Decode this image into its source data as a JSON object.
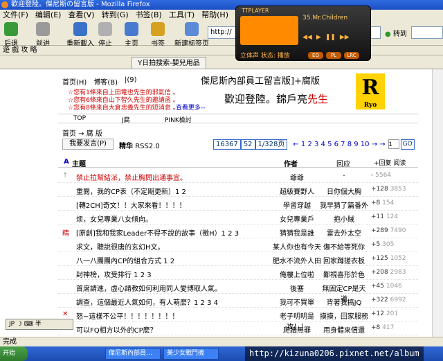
{
  "window": {
    "title": "歡迎登陸。傑尼斯の留言版 - Mozilla Firefox"
  },
  "menu": [
    "文件(F)",
    "编辑(E)",
    "查看(V)",
    "转到(G)",
    "书签(B)",
    "工具(T)",
    "帮助(H)"
  ],
  "toolbar": {
    "back": "后退",
    "forward": "前进",
    "reload": "重新載入",
    "stop": "停止",
    "home": "主页",
    "bookmarks": "书签",
    "newtab": "新建标签页",
    "url": "http://",
    "goto": "转到"
  },
  "bookmarks_bar": "遊 戲 攻 略",
  "tabs": [
    "Y日拍搜索-嬰兒用品"
  ],
  "player": {
    "name": "TTPLAYER",
    "song": "35.Mr.Children",
    "status": "立体声 状态: 播放",
    "buttons": [
      "EQ",
      "PL",
      "LRC"
    ]
  },
  "board": {
    "header_links": [
      "首页(H)",
      "博客(B)",
      "|(9)"
    ],
    "title": "傑尼斯內部員工留言版]+腐版",
    "welcome_lines": [
      "☆您有1條來自上田竜也先生的邪氣信 。",
      "☆您有6條來自山下智久先生的邀請函 。",
      "☆您有8條來自大倉忠義先生的短消息 。"
    ],
    "more": "查看更多--",
    "welcome": "歡迎登陸。錦戶亮",
    "welcome_name": "先生",
    "logo": "R",
    "logo_sub": "Ryo",
    "nav": [
      "TOP",
      "J腐",
      "PINK檢討"
    ],
    "breadcrumb": "首页 → 腐 版",
    "post_button": "我要发言(P)",
    "rss_bold": "精华",
    "rss": "RSS2.0",
    "pager": {
      "total": "16367",
      "per": "52",
      "page": "1/328页",
      "pages": "← 1 2 3 4 5 6 7 8 9 10 → →",
      "input": "1",
      "go": "GO"
    },
    "list_head": {
      "title": "主题",
      "author": "作者",
      "reply": "回应",
      "stats": "+回复 阅读"
    }
  },
  "rows": [
    {
      "mark": "↑",
      "title": "禁止拉幫結派，禁止胸問出通事宜。",
      "author": "爺爺",
      "reply": "-",
      "count": "-",
      "views": "5564",
      "color": "#c00"
    },
    {
      "mark": "",
      "title": "重閱，我的CP表（不定期更新）1 2",
      "author": "超級賽野人",
      "reply": "日你個大胸",
      "count": "+128",
      "views": "3853",
      "color": "#000"
    },
    {
      "mark": "",
      "title": "[轉2CH]奇文！！大家來看！！！！",
      "author": "學習穿越",
      "reply": "我早猜了篇番外",
      "count": "+8",
      "views": "154",
      "color": "#000"
    },
    {
      "mark": "",
      "title": "烦，女兒專業八女傾向。",
      "author": "女兒專業戶",
      "reply": "抱小賊",
      "count": "+11",
      "views": "124",
      "color": "#000"
    },
    {
      "mark": "精",
      "title": "[原創]我和我家Leader不得不說的故事（徵H）1 2 3",
      "author": "猜猜我是誰",
      "reply": "雷去外太空",
      "count": "+289",
      "views": "7490",
      "color": "#000"
    },
    {
      "mark": "",
      "title": "求文，聽說很唐的玄幻H文。",
      "author": "某人你也有今天",
      "reply": "傷不給等死你",
      "count": "+5",
      "views": "305",
      "color": "#000"
    },
    {
      "mark": "",
      "title": "八一八團團內CP的組合方式 1 2",
      "author": "肥水不流外人田",
      "reply": "回家蹲搓衣板",
      "count": "+125",
      "views": "1052",
      "color": "#000"
    },
    {
      "mark": "",
      "title": "封神榜，攻受排行 1 2 3",
      "author": "俺樓上位啦",
      "reply": "鄙視喜形於色",
      "count": "+208",
      "views": "2983",
      "color": "#000"
    },
    {
      "mark": "",
      "title": "首席請進，虛心請教如何利用同人愛博取人氣。",
      "author": "後塞",
      "reply": "無固定CP是天道",
      "count": "+45",
      "views": "1046",
      "color": "#000"
    },
    {
      "mark": "",
      "title": "調查，這個最近人氣如何，有人萌麼？1 2 3 4",
      "author": "我可不買單",
      "reply": "背著我搞JQ",
      "count": "+322",
      "views": "6992",
      "color": "#000"
    },
    {
      "mark": "✕",
      "title": "怒~這樣不公平！！！！！！！！",
      "author": "老子明明是攻！！",
      "reply": "摸摸，回家服務",
      "count": "+12",
      "views": "201",
      "color": "#000"
    },
    {
      "mark": "",
      "title": "可以FQ相方以外的CP麼？",
      "author": "爬牆無罪",
      "reply": "用身體來償還",
      "count": "+8",
      "views": "417",
      "color": "#000"
    }
  ],
  "ime": "JP ☽ ⌨ 半",
  "status": "完成",
  "taskbar": {
    "start": "开始",
    "tasks": [
      "傑尼斯內部員…",
      "美少女戰鬥機"
    ]
  },
  "watermark": "http://kizuna0206.pixnet.net/album"
}
